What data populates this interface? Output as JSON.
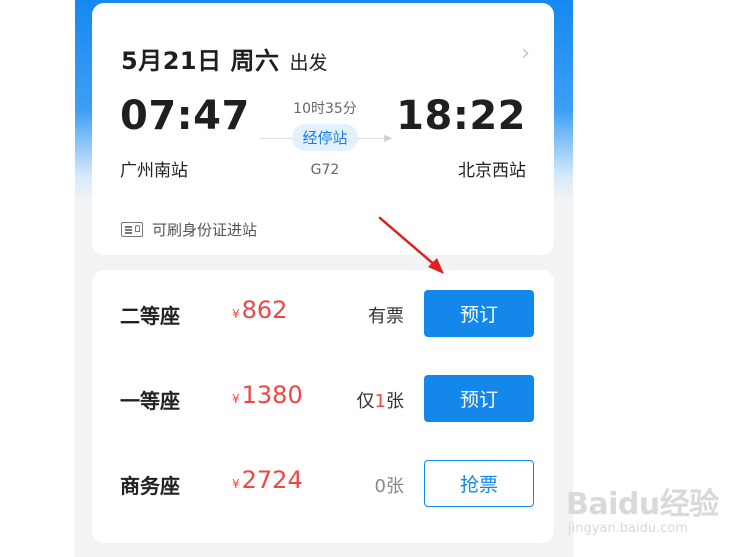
{
  "header": {
    "date": "5月21日 周六",
    "depart_label": "出发",
    "chevron_icon": "chevron-right-icon"
  },
  "trip": {
    "depart_time": "07:47",
    "arrive_time": "18:22",
    "depart_station": "广州南站",
    "arrive_station": "北京西站",
    "duration": "10时35分",
    "via_label": "经停站",
    "train_no": "G72"
  },
  "id_notice": {
    "icon": "id-card-icon",
    "text": "可刷身份证进站"
  },
  "seats": [
    {
      "name": "二等座",
      "currency": "¥",
      "price": "862",
      "avail_prefix": "有票",
      "avail_num": "",
      "avail_suffix": "",
      "button": "预订",
      "style": "primary"
    },
    {
      "name": "一等座",
      "currency": "¥",
      "price": "1380",
      "avail_prefix": "仅",
      "avail_num": "1",
      "avail_suffix": "张",
      "button": "预订",
      "style": "primary"
    },
    {
      "name": "商务座",
      "currency": "¥",
      "price": "2724",
      "avail_prefix": "0张",
      "avail_num": "",
      "avail_suffix": "",
      "button": "抢票",
      "style": "outline"
    }
  ],
  "colors": {
    "brand_blue": "#1487eb",
    "price_red": "#f04646",
    "annotation_arrow": "#e02020"
  },
  "watermark": {
    "main": "Baidu经验",
    "sub": "jingyan.baidu.com"
  }
}
